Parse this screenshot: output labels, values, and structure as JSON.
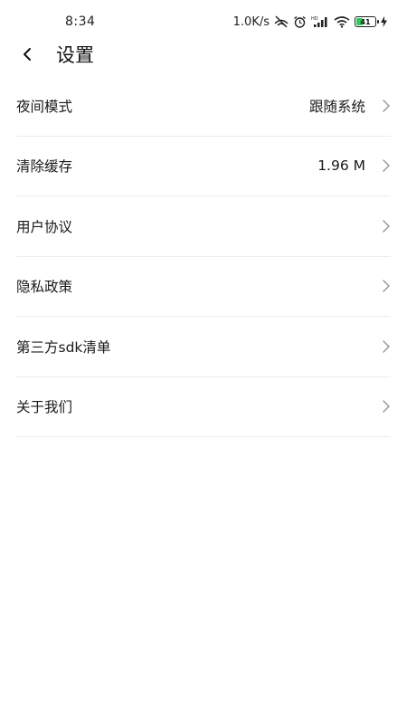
{
  "status_bar": {
    "time": "8:34",
    "network_speed": "1.0K/s",
    "battery_level": "41"
  },
  "header": {
    "title": "设置"
  },
  "settings": [
    {
      "label": "夜间模式",
      "value": "跟随系统"
    },
    {
      "label": "清除缓存",
      "value": "1.96 M"
    },
    {
      "label": "用户协议",
      "value": ""
    },
    {
      "label": "隐私政策",
      "value": ""
    },
    {
      "label": "第三方sdk清单",
      "value": ""
    },
    {
      "label": "关于我们",
      "value": ""
    }
  ],
  "colors": {
    "divider": "#ececec",
    "chevron": "#9a9a9a",
    "battery": "#34c759"
  }
}
